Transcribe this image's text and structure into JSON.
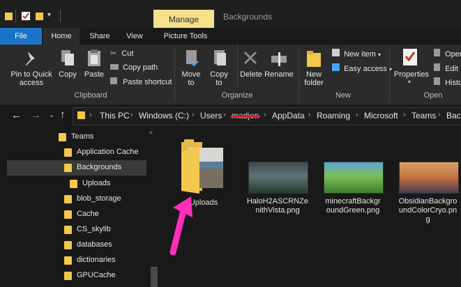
{
  "window": {
    "manage_tab": "Manage",
    "title": "Backgrounds"
  },
  "ribbon_tabs": [
    "File",
    "Home",
    "Share",
    "View",
    "Picture Tools"
  ],
  "clipboard": {
    "pin_label": "Pin to Quick access",
    "copy_label": "Copy",
    "paste_label": "Paste",
    "cut": "Cut",
    "copy_path": "Copy path",
    "paste_shortcut": "Paste shortcut",
    "group": "Clipboard"
  },
  "organize": {
    "move_to": "Move to",
    "copy_to": "Copy to",
    "delete": "Delete",
    "rename": "Rename",
    "group": "Organize"
  },
  "new": {
    "new_folder": "New folder",
    "new_item": "New item",
    "easy_access": "Easy access",
    "group": "New"
  },
  "open": {
    "properties": "Properties",
    "open": "Open",
    "edit": "Edit",
    "history": "Histo",
    "group": "Open"
  },
  "breadcrumb": [
    "This PC",
    "Windows (C:)",
    "Users",
    "madjen",
    "AppData",
    "Roaming",
    "Microsoft",
    "Teams",
    "Back"
  ],
  "sidebar": {
    "root": "Teams",
    "items": [
      "Application Cache",
      "Backgrounds",
      "Uploads",
      "blob_storage",
      "Cache",
      "CS_skylib",
      "databases",
      "dictionaries",
      "GPUCache"
    ]
  },
  "files": [
    {
      "name": "Uploads"
    },
    {
      "name": "HaloH2ASCRNZe\nnithVista.png"
    },
    {
      "name": "minecraftBackgr\noundGreen.png"
    },
    {
      "name": "ObsidianBackgro\nundColorCryo.pn\ng"
    }
  ],
  "colors": {
    "accent": "#1a73c9",
    "manage": "#f6e08c",
    "folder": "#f2c94c",
    "arrow": "#ff2ebd",
    "redacted_underline": "#e0202a"
  }
}
